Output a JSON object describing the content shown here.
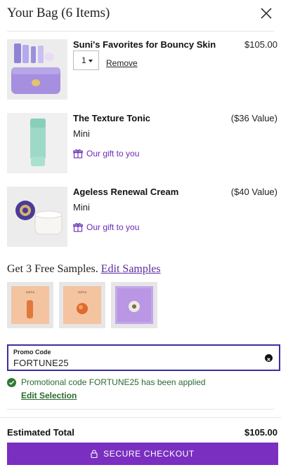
{
  "header": {
    "title": "Your Bag (6 Items)",
    "close_icon": "close-icon"
  },
  "items": [
    {
      "name": "Suni's Favorites for Bouncy Skin",
      "price": "$105.00",
      "quantity": "1",
      "remove_label": "Remove"
    },
    {
      "name": "The Texture Tonic",
      "price": "($36 Value)",
      "size": "Mini",
      "gift_label": "Our gift to you",
      "gift_icon": "gift-icon"
    },
    {
      "name": "Ageless Renewal Cream",
      "price": "($40 Value)",
      "size": "Mini",
      "gift_label": "Our gift to you",
      "gift_icon": "gift-icon"
    }
  ],
  "samples": {
    "heading": "Get 3 Free Samples.",
    "edit_label": "Edit Samples",
    "items": [
      "tatcha",
      "tatcha",
      ""
    ]
  },
  "promo": {
    "label": "Promo Code",
    "value": "FORTUNE25",
    "status": "Promotional code FORTUNE25 has been applied",
    "edit_selection": "Edit Selection"
  },
  "summary": {
    "total_label": "Estimated Total",
    "total_value": "$105.00",
    "checkout_label": "SECURE CHECKOUT"
  },
  "colors": {
    "brand_purple": "#7a2fc0",
    "gift_purple": "#6a2bb5",
    "promo_border": "#3a2fa0",
    "success_green": "#2b6a2f"
  }
}
